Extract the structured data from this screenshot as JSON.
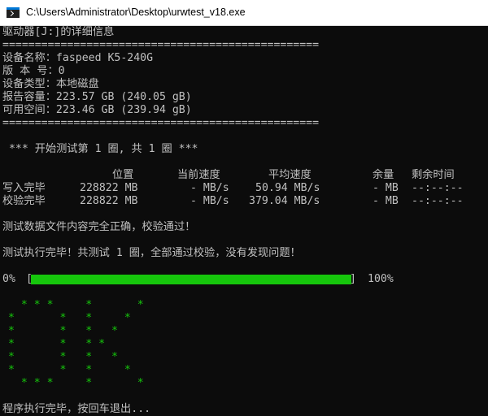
{
  "window": {
    "title": "C:\\Users\\Administrator\\Desktop\\urwtest_v18.exe"
  },
  "console": {
    "header": "驱动器[J:]的详细信息",
    "separator": "=================================================",
    "device_name": "设备名称：faspeed K5-240G",
    "version": "版 本 号：0",
    "device_type": "设备类型：本地磁盘",
    "reported_capacity": "报告容量：223.57 GB (240.05 gB)",
    "available_space": "可用空间：223.46 GB (239.94 gB)",
    "round_banner": " *** 开始测试第 1 圈, 共 1 圈 ***",
    "columns": {
      "position": "位置",
      "current_speed": "当前速度",
      "avg_speed": "平均速度",
      "remaining": "余量",
      "time_left": "剩余时间"
    },
    "rows": [
      {
        "label": "写入完毕",
        "position": "228822 MB",
        "current_speed": "- MB/s",
        "avg_speed": "50.94 MB/s",
        "remaining": "- MB",
        "time_left": "--:--:--"
      },
      {
        "label": "校验完毕",
        "position": "228822 MB",
        "current_speed": "- MB/s",
        "avg_speed": "379.04 MB/s",
        "remaining": "- MB",
        "time_left": "--:--:--"
      }
    ],
    "verify_msg": "测试数据文件内容完全正确，校验通过！",
    "done_msg": "测试执行完毕！共测试 1 圈，全部通过校验，没有发现问题！",
    "progress": {
      "start_label": "0%",
      "end_label": "100%",
      "fraction": 1.0,
      "bracket_open": "[",
      "bracket_close": "]"
    },
    "ok_art": [
      "  * * *     *       *",
      "*       *   *     *",
      "*       *   *   *",
      "*       *   * *",
      "*       *   *   *",
      "*       *   *     *",
      "  * * *     *       *"
    ],
    "exit_msg": "程序执行完毕，按回车退出..."
  },
  "colors": {
    "accent_green": "#16c60c",
    "console_bg": "#0c0c0c",
    "console_text": "#c0c0c0"
  }
}
